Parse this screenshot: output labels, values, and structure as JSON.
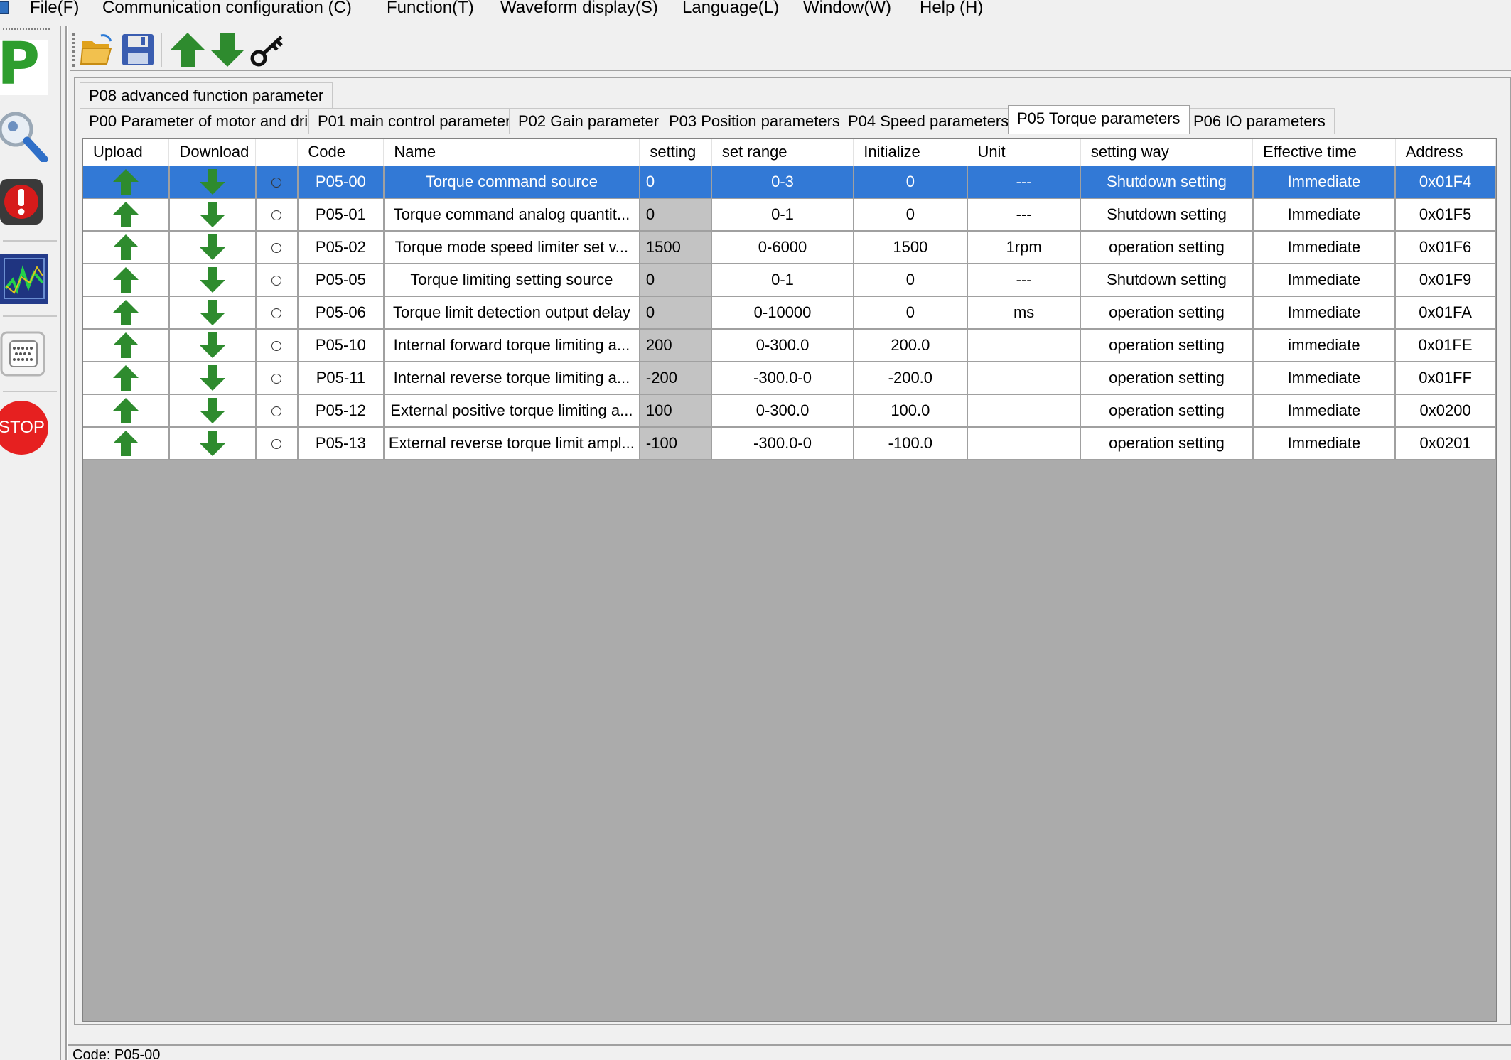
{
  "menu": {
    "items": [
      {
        "label": "File(F)"
      },
      {
        "label": "Communication configuration (C)"
      },
      {
        "label": "Function(T)"
      },
      {
        "label": "Waveform display(S)"
      },
      {
        "label": "Language(L)"
      },
      {
        "label": "Window(W)"
      },
      {
        "label": "Help (H)"
      }
    ]
  },
  "left_toolbar": {
    "p_label": "P",
    "stop_label": "STOP"
  },
  "tabs": {
    "row_top": [
      {
        "label": "P08 advanced function parameter"
      }
    ],
    "row_main": [
      {
        "label": "P00  Parameter of motor and dri"
      },
      {
        "label": "P01 main control parameter"
      },
      {
        "label": "P02 Gain parameter"
      },
      {
        "label": "P03 Position parameters"
      },
      {
        "label": "P04 Speed parameters"
      },
      {
        "label": "P05 Torque parameters"
      },
      {
        "label": "P06 IO parameters"
      }
    ]
  },
  "table": {
    "headers": {
      "upload": "Upload",
      "download": "Download",
      "radio": "",
      "code": "Code",
      "name": "Name",
      "setting": "setting",
      "set_range": "set range",
      "initialize": "Initialize",
      "unit": "Unit",
      "setting_way": "setting way",
      "effective_time": "Effective time",
      "address": "Address"
    },
    "rows": [
      {
        "code": "P05-00",
        "name": "Torque command source",
        "setting": "0",
        "set_range": "0-3",
        "initialize": "0",
        "unit": "---",
        "setting_way": "Shutdown setting",
        "effective_time": "Immediate",
        "address": "0x01F4"
      },
      {
        "code": "P05-01",
        "name": "Torque command analog quantit...",
        "setting": "0",
        "set_range": "0-1",
        "initialize": "0",
        "unit": "---",
        "setting_way": "Shutdown setting",
        "effective_time": "Immediate",
        "address": "0x01F5"
      },
      {
        "code": "P05-02",
        "name": "Torque mode speed limiter set v...",
        "setting": "1500",
        "set_range": "0-6000",
        "initialize": "1500",
        "unit": "1rpm",
        "setting_way": "operation setting",
        "effective_time": "Immediate",
        "address": "0x01F6"
      },
      {
        "code": "P05-05",
        "name": "Torque limiting setting source",
        "setting": "0",
        "set_range": "0-1",
        "initialize": "0",
        "unit": "---",
        "setting_way": "Shutdown setting",
        "effective_time": "Immediate",
        "address": "0x01F9"
      },
      {
        "code": "P05-06",
        "name": "Torque limit detection output delay",
        "setting": "0",
        "set_range": "0-10000",
        "initialize": "0",
        "unit": "ms",
        "setting_way": "operation setting",
        "effective_time": "Immediate",
        "address": "0x01FA"
      },
      {
        "code": "P05-10",
        "name": "Internal forward torque limiting a...",
        "setting": "200",
        "set_range": "0-300.0",
        "initialize": "200.0",
        "unit": "",
        "setting_way": "operation setting",
        "effective_time": "immediate",
        "address": "0x01FE"
      },
      {
        "code": "P05-11",
        "name": "Internal reverse torque limiting a...",
        "setting": "-200",
        "set_range": "-300.0-0",
        "initialize": "-200.0",
        "unit": "",
        "setting_way": "operation setting",
        "effective_time": "Immediate",
        "address": "0x01FF"
      },
      {
        "code": "P05-12",
        "name": "External positive torque limiting a...",
        "setting": "100",
        "set_range": "0-300.0",
        "initialize": "100.0",
        "unit": "",
        "setting_way": "operation setting",
        "effective_time": "Immediate",
        "address": "0x0200"
      },
      {
        "code": "P05-13",
        "name": "External reverse torque limit ampl...",
        "setting": "-100",
        "set_range": "-300.0-0",
        "initialize": "-100.0",
        "unit": "",
        "setting_way": "operation setting",
        "effective_time": "Immediate",
        "address": "0x0201"
      }
    ]
  },
  "statusbar": {
    "text": "Code:  P05-00"
  },
  "colors": {
    "arrow_green": "#2e8b2e",
    "selection": "#3279d6",
    "grid_bg": "#ababab"
  }
}
